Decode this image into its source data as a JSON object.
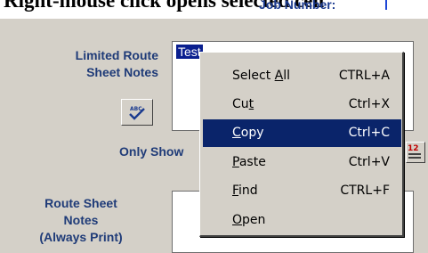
{
  "header": {
    "title_fragment": "Right-mouse click opens selected cell",
    "job_number_label": "Job Number:"
  },
  "form": {
    "limited_route_label_line1": "Limited Route",
    "limited_route_label_line2": "Sheet Notes",
    "notes_value": "Test",
    "only_show_label": "Only Show",
    "route_sheet_label_line1": "Route Sheet",
    "route_sheet_label_line2": "Notes",
    "route_sheet_label_line3": "(Always Print)",
    "spell_check_icon": "spell-check-icon"
  },
  "context_menu": {
    "items": [
      {
        "pre": "Select ",
        "key": "A",
        "post": "ll",
        "shortcut": "CTRL+A"
      },
      {
        "pre": "Cu",
        "key": "t",
        "post": "",
        "shortcut": "Ctrl+X"
      },
      {
        "pre": "",
        "key": "C",
        "post": "opy",
        "shortcut": "Ctrl+C"
      },
      {
        "pre": "",
        "key": "P",
        "post": "aste",
        "shortcut": "Ctrl+V"
      },
      {
        "pre": "",
        "key": "F",
        "post": "ind",
        "shortcut": "CTRL+F"
      },
      {
        "pre": "",
        "key": "O",
        "post": "pen",
        "shortcut": ""
      }
    ],
    "selected_index": 2
  },
  "colors": {
    "label_blue": "#1f3b78",
    "highlight": "#0a246a",
    "window_bg": "#d4d0c8"
  }
}
